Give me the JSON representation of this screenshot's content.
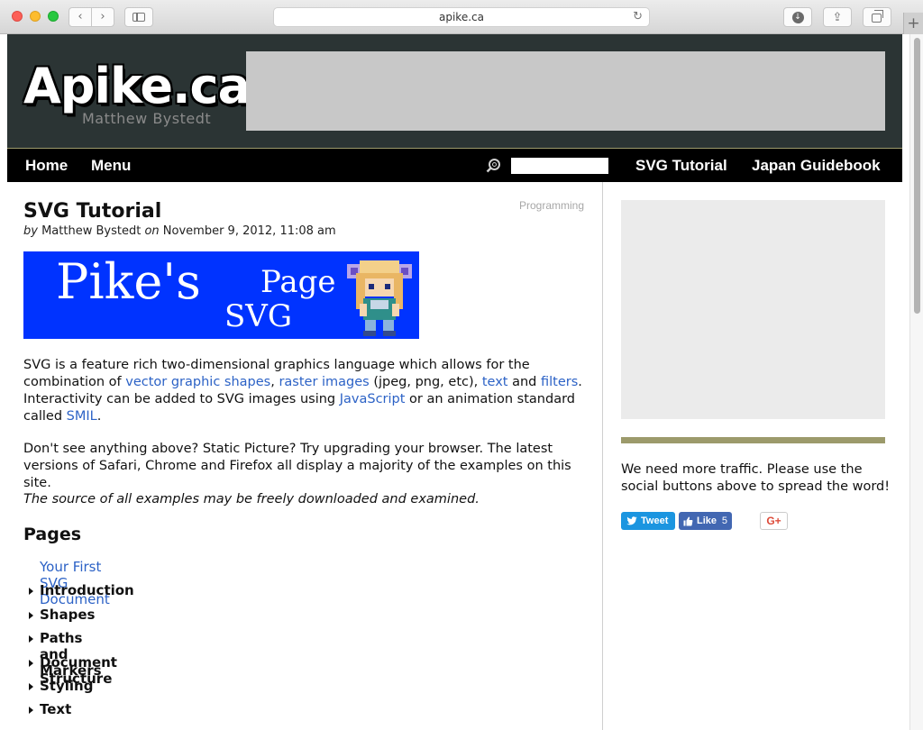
{
  "browser": {
    "url": "apike.ca",
    "back_glyph": "‹",
    "forward_glyph": "›",
    "reload_glyph": "↻",
    "download_glyph": "↓",
    "share_glyph": "⇪",
    "newtab_glyph": "+"
  },
  "header": {
    "logo": "Apike.ca",
    "tagline": "Matthew Bystedt"
  },
  "nav": {
    "home": "Home",
    "menu": "Menu",
    "svg_tutorial": "SVG Tutorial",
    "japan_guidebook": "Japan Guidebook",
    "search_placeholder": ""
  },
  "post": {
    "category": "Programming",
    "title": "SVG Tutorial",
    "byline_by": "by",
    "author": "Matthew Bystedt",
    "byline_on": "on",
    "date": "November 9, 2012, 11:08 am",
    "feature_image": {
      "line1": "Pike's",
      "line2": "Page",
      "line3": "SVG"
    },
    "p1": {
      "t1": "SVG is a feature rich two-dimensional graphics language which allows for the combination of ",
      "link_vector": "vector graphic shapes",
      "t2": ", ",
      "link_raster": "raster images",
      "t3": " (jpeg, png, etc), ",
      "link_text": "text",
      "t4": " and ",
      "link_filters": "filters",
      "t5": ". Interactivity can be added to SVG images using ",
      "link_js": "JavaScript",
      "t6": " or an animation standard called ",
      "link_smil": "SMIL",
      "t7": "."
    },
    "p2": "Don't see anything above? Static Picture? Try upgrading your browser. The latest versions of Safari, Chrome and Firefox all display a majority of the examples on this site.",
    "p3": "The source of all examples may be freely downloaded and examined.",
    "pages_heading": "Pages",
    "pages": {
      "first": "Your First SVG Document",
      "items": [
        "Introduction",
        "Shapes",
        "Paths and Markers",
        "Document Structure",
        "Styling",
        "Text"
      ]
    }
  },
  "sidebar": {
    "message": "We need more traffic. Please use the social buttons above to spread the word!",
    "tweet_label": "Tweet",
    "like_label": "Like",
    "like_count": "5",
    "gplus_label": "G+"
  }
}
